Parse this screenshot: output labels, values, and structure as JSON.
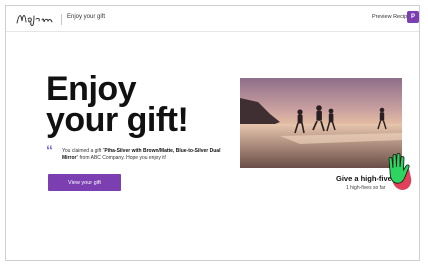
{
  "header": {
    "logo_text": "Maui Jim",
    "breadcrumb": "Enjoy your gift",
    "preview_label": "Preview Recipient",
    "avatar_initial": "P"
  },
  "hero": {
    "headline_line1": "Enjoy",
    "headline_line2": "your gift!",
    "quote_glyph": "“",
    "message_intro": "You claimed a gift “",
    "message_product": "Piha-Silver with Brown/Matte, Blue-to-Silver Dual Mirror",
    "message_outro": "” from ABC Company. Hope you enjoy it!",
    "button_label": "View your gift"
  },
  "high_five": {
    "title": "Give a high-five",
    "count": "1 high-fives so far"
  },
  "colors": {
    "accent": "#7b3fb1",
    "hand": "#2fd35f",
    "hand_shadow": "#e0405a"
  }
}
